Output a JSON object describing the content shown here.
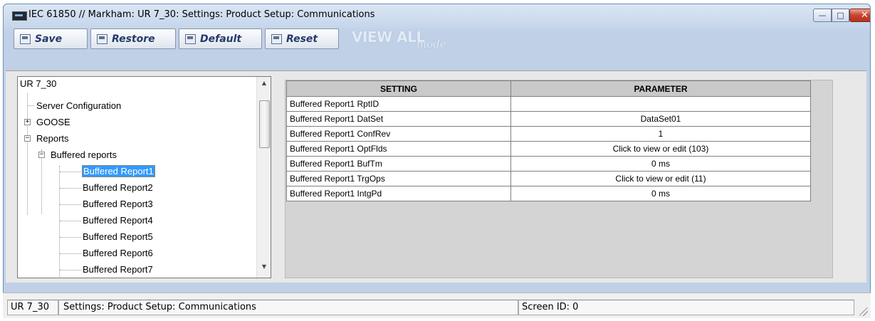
{
  "window": {
    "title": "IEC 61850 // Markham: UR 7_30: Settings: Product Setup: Communications",
    "controls": {
      "minimize": "—",
      "maximize": "□",
      "close": "✕"
    }
  },
  "toolbar": {
    "save_label": "Save",
    "restore_label": "Restore",
    "default_label": "Default",
    "reset_label": "Reset",
    "viewall_label": "VIEW ALL",
    "mode_label": "mode"
  },
  "tree": {
    "root": "UR 7_30",
    "items": [
      {
        "label": "Server Configuration"
      },
      {
        "label": "GOOSE"
      },
      {
        "label": "Reports"
      },
      {
        "label": "Buffered reports"
      },
      {
        "label": "Buffered Report1"
      },
      {
        "label": "Buffered Report2"
      },
      {
        "label": "Buffered Report3"
      },
      {
        "label": "Buffered Report4"
      },
      {
        "label": "Buffered Report5"
      },
      {
        "label": "Buffered Report6"
      },
      {
        "label": "Buffered Report7"
      }
    ],
    "selected": "Buffered Report1"
  },
  "grid": {
    "headers": [
      "SETTING",
      "PARAMETER"
    ],
    "rows": [
      {
        "setting": "Buffered Report1 RptID",
        "parameter": ""
      },
      {
        "setting": "Buffered Report1 DatSet",
        "parameter": "DataSet01"
      },
      {
        "setting": "Buffered Report1 ConfRev",
        "parameter": "1"
      },
      {
        "setting": "Buffered Report1 OptFlds",
        "parameter": "Click to view or edit (103)"
      },
      {
        "setting": "Buffered Report1 BufTm",
        "parameter": "0 ms"
      },
      {
        "setting": "Buffered Report1 TrgOps",
        "parameter": "Click to view or edit (11)"
      },
      {
        "setting": "Buffered Report1 IntgPd",
        "parameter": "0 ms"
      }
    ]
  },
  "status": {
    "device": "UR 7_30",
    "path": "Settings: Product Setup: Communications",
    "screen_id": "Screen ID: 0"
  }
}
